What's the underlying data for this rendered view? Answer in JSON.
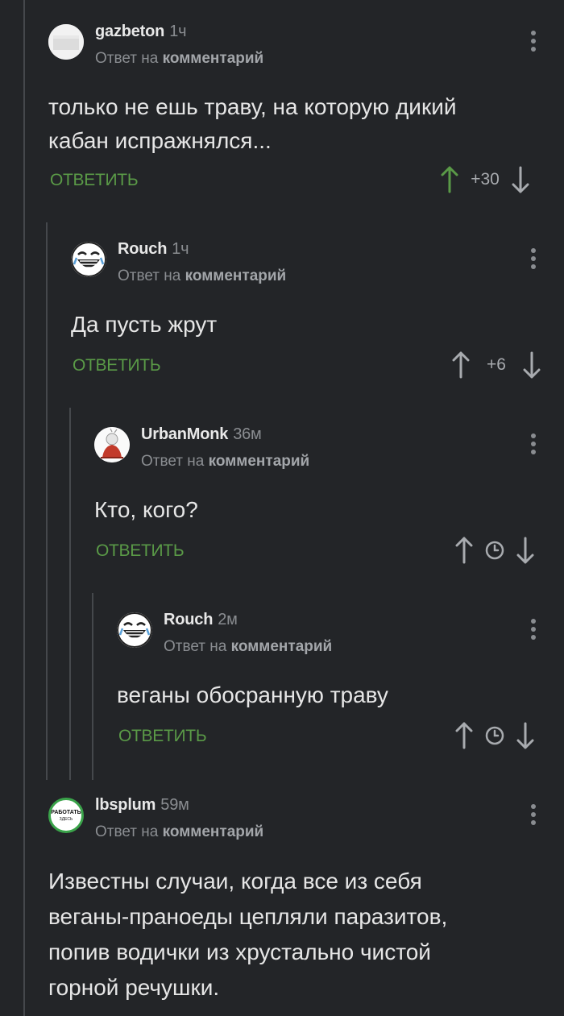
{
  "reply_to_prefix": "Ответ на",
  "reply_to_target": "комментарий",
  "comments": [
    {
      "author": "gazbeton",
      "time": "1ч",
      "text_lines": [
        "только не ешь траву, на которую дикий",
        "кабан испражнялся..."
      ],
      "reply_label": "ОТВЕТИТЬ",
      "rating": "+30",
      "upvoted": true,
      "avatar": "white-box-avatar"
    },
    {
      "author": "Rouch",
      "time": "1ч",
      "text_lines": [
        "Да пусть жрут"
      ],
      "reply_label": "ОТВЕТИТЬ",
      "rating": "+6",
      "avatar": "laughing-face-avatar"
    },
    {
      "author": "UrbanMonk",
      "time": "36м",
      "text_lines": [
        "Кто, кого?"
      ],
      "reply_label": "ОТВЕТИТЬ",
      "rating": "",
      "rating_icon": "clock-icon",
      "avatar": "monk-avatar"
    },
    {
      "author": "Rouch",
      "time": "2м",
      "text_lines": [
        "веганы обосранную траву"
      ],
      "reply_label": "ОТВЕТИТЬ",
      "rating": "",
      "rating_icon": "clock-icon",
      "avatar": "laughing-face-avatar"
    },
    {
      "author": "lbsplum",
      "time": "59м",
      "text_lines": [
        "Известны случаи, когда все из себя",
        "веганы-праноеды цепляли паразитов,",
        "попив водички из хрустально чистой",
        "горной речушки."
      ],
      "avatar": "rabotat-zdes-avatar",
      "avatar_text": [
        "РАБОТАТЬ",
        "ЗДЕСЬ"
      ]
    }
  ],
  "colors": {
    "background": "#232528",
    "reply_green": "#5a9a47",
    "thread_line": "#45484c",
    "upvote_active": "#5a9a47"
  }
}
